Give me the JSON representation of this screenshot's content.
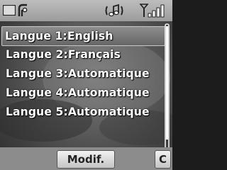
{
  "status_bar": {
    "icons": [
      "message-envelope-icon",
      "signal-antenna-icon",
      "ringer-music-note-icon",
      "signal-strength-bars-icon"
    ]
  },
  "menu": {
    "items": [
      {
        "label": "Langue 1:English",
        "selected": true
      },
      {
        "label": "Langue 2:Français",
        "selected": false
      },
      {
        "label": "Langue 3:Automatique",
        "selected": false
      },
      {
        "label": "Langue 4:Automatique",
        "selected": false
      },
      {
        "label": "Langue 5:Automatique",
        "selected": false
      }
    ]
  },
  "softkeys": {
    "modify_label": "Modif.",
    "clear_label": "C"
  },
  "colors": {
    "status_bar": "#a8a8a8",
    "selection": "#7a7a7a",
    "text": "#ffffff"
  }
}
